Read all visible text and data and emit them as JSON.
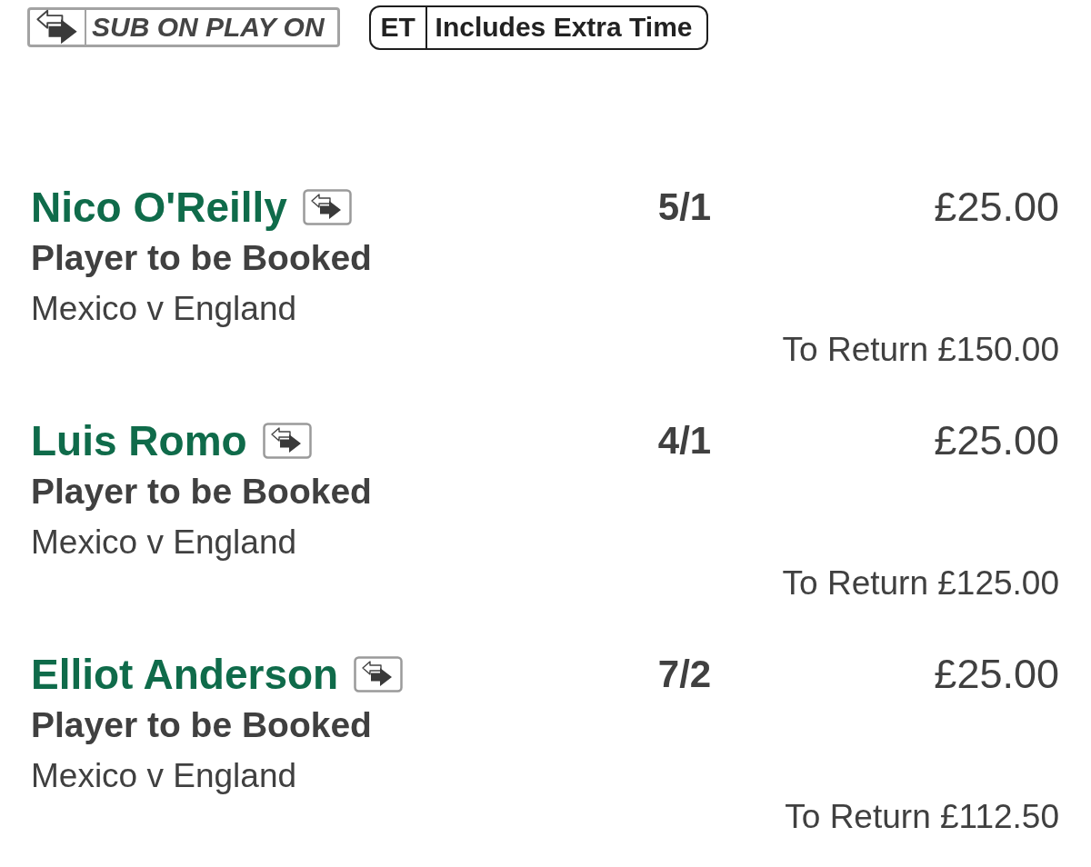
{
  "legend": [
    {
      "kind": "sub",
      "label": "SUB ON PLAY ON"
    },
    {
      "kind": "et",
      "code": "ET",
      "label": "Includes Extra Time"
    }
  ],
  "bets": [
    {
      "player": "Nico O'Reilly",
      "sub_on_play_on": true,
      "market": "Player to be Booked",
      "event": "Mexico v England",
      "odds": "5/1",
      "stake": "£25.00",
      "to_return": "To Return £150.00"
    },
    {
      "player": "Luis Romo",
      "sub_on_play_on": true,
      "market": "Player to be Booked",
      "event": "Mexico v England",
      "odds": "4/1",
      "stake": "£25.00",
      "to_return": "To Return £125.00"
    },
    {
      "player": "Elliot Anderson",
      "sub_on_play_on": true,
      "market": "Player to be Booked",
      "event": "Mexico v England",
      "odds": "7/2",
      "stake": "£25.00",
      "to_return": "To Return £112.50"
    }
  ]
}
